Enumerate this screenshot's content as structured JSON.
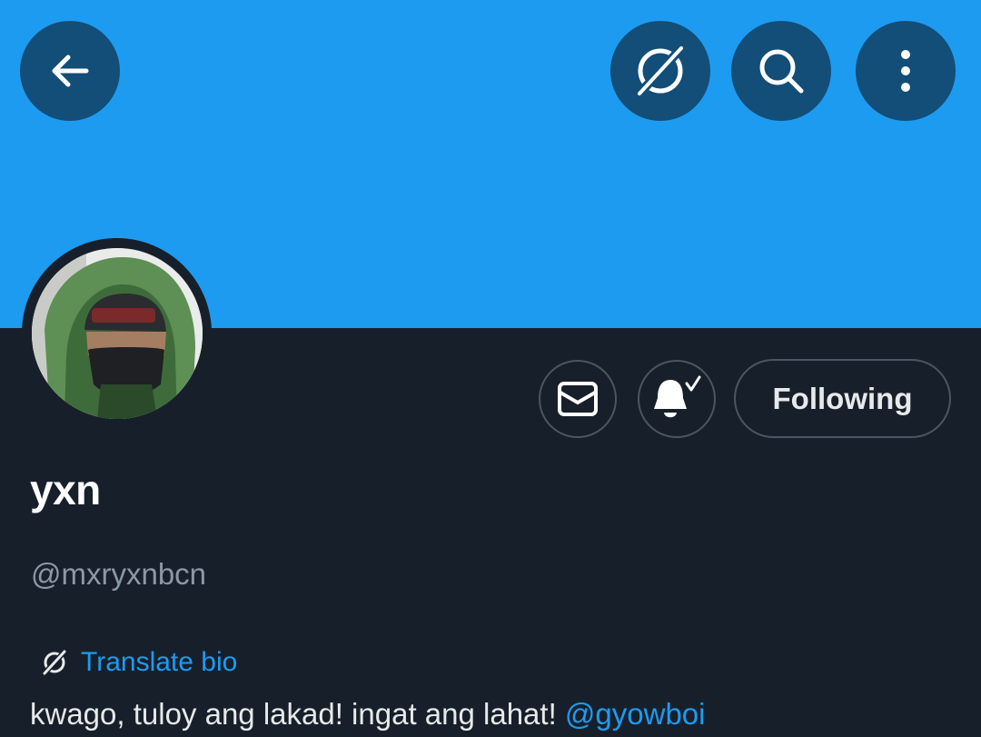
{
  "header": {
    "back_icon": "arrow-left-icon",
    "spaces_icon": "translate-globe-icon",
    "search_icon": "search-icon",
    "more_icon": "vertical-ellipsis-icon"
  },
  "colors": {
    "banner": "#1d9bf0",
    "background": "#17202a",
    "accent": "#1d9bf0",
    "circle_button": "#124e77",
    "muted_text": "#8b98a5"
  },
  "profile": {
    "display_name": "yxn",
    "handle": "@mxryxnbcn",
    "translate_label": "Translate bio",
    "bio_text": "kwago, tuloy ang lakad! ingat ang lahat! ",
    "bio_mention": "@gyowboi"
  },
  "actions": {
    "message_icon": "envelope-icon",
    "notify_icon": "bell-check-icon",
    "following_label": "Following"
  }
}
